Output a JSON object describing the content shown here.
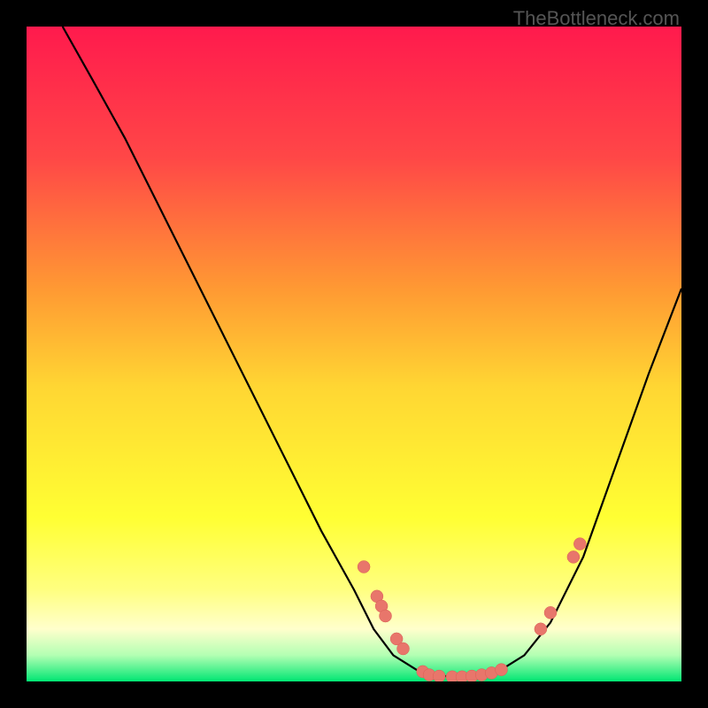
{
  "watermark": "TheBottleneck.com",
  "chart_data": {
    "type": "line",
    "title": "",
    "xlabel": "",
    "ylabel": "",
    "xlim": [
      0,
      100
    ],
    "ylim": [
      0,
      100
    ],
    "background": {
      "gradient_stops": [
        {
          "offset": 0,
          "color": "#ff1a4d"
        },
        {
          "offset": 0.2,
          "color": "#ff4747"
        },
        {
          "offset": 0.4,
          "color": "#ff9933"
        },
        {
          "offset": 0.55,
          "color": "#ffd633"
        },
        {
          "offset": 0.75,
          "color": "#ffff33"
        },
        {
          "offset": 0.86,
          "color": "#ffff80"
        },
        {
          "offset": 0.92,
          "color": "#ffffcc"
        },
        {
          "offset": 0.96,
          "color": "#b3ffb3"
        },
        {
          "offset": 1.0,
          "color": "#00e673"
        }
      ]
    },
    "curve": [
      {
        "x": 5.5,
        "y": 100
      },
      {
        "x": 10,
        "y": 92
      },
      {
        "x": 15,
        "y": 83
      },
      {
        "x": 20,
        "y": 73
      },
      {
        "x": 25,
        "y": 63
      },
      {
        "x": 30,
        "y": 53
      },
      {
        "x": 35,
        "y": 43
      },
      {
        "x": 40,
        "y": 33
      },
      {
        "x": 45,
        "y": 23
      },
      {
        "x": 50,
        "y": 14
      },
      {
        "x": 53,
        "y": 8
      },
      {
        "x": 56,
        "y": 4
      },
      {
        "x": 60,
        "y": 1.5
      },
      {
        "x": 64,
        "y": 0.8
      },
      {
        "x": 68,
        "y": 0.8
      },
      {
        "x": 72,
        "y": 1.5
      },
      {
        "x": 76,
        "y": 4
      },
      {
        "x": 80,
        "y": 9
      },
      {
        "x": 85,
        "y": 19
      },
      {
        "x": 90,
        "y": 33
      },
      {
        "x": 95,
        "y": 47
      },
      {
        "x": 100,
        "y": 60
      }
    ],
    "points": [
      {
        "x": 51.5,
        "y": 17.5
      },
      {
        "x": 53.5,
        "y": 13
      },
      {
        "x": 54.2,
        "y": 11.5
      },
      {
        "x": 54.8,
        "y": 10
      },
      {
        "x": 56.5,
        "y": 6.5
      },
      {
        "x": 57.5,
        "y": 5
      },
      {
        "x": 60.5,
        "y": 1.5
      },
      {
        "x": 61.5,
        "y": 1
      },
      {
        "x": 63,
        "y": 0.8
      },
      {
        "x": 65,
        "y": 0.7
      },
      {
        "x": 66.5,
        "y": 0.7
      },
      {
        "x": 68,
        "y": 0.8
      },
      {
        "x": 69.5,
        "y": 1
      },
      {
        "x": 71,
        "y": 1.3
      },
      {
        "x": 72.5,
        "y": 1.8
      },
      {
        "x": 78.5,
        "y": 8
      },
      {
        "x": 80,
        "y": 10.5
      },
      {
        "x": 83.5,
        "y": 19
      },
      {
        "x": 84.5,
        "y": 21
      }
    ],
    "colors": {
      "curve": "#000000",
      "point_fill": "#e8766b",
      "point_stroke": "#d95f55"
    }
  }
}
